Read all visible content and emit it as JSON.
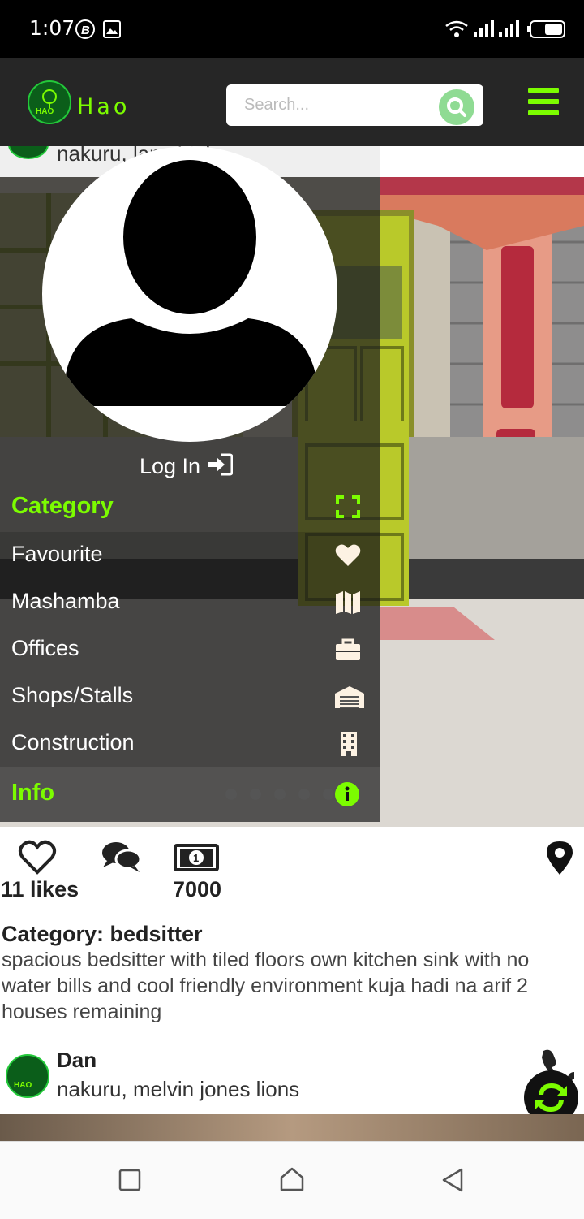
{
  "status_bar": {
    "time": "1:07"
  },
  "header": {
    "app_name": "Hao",
    "logo_text": "HAO",
    "search_placeholder": "Search...",
    "accent": "#7CFC00"
  },
  "drawer": {
    "partial_location": "nakuru, lan   chini",
    "login_label": "Log In",
    "menu": [
      {
        "label": "Category",
        "icon": "expand-icon",
        "heading": true
      },
      {
        "label": "Favourite",
        "icon": "heart-icon"
      },
      {
        "label": "Mashamba",
        "icon": "map-icon"
      },
      {
        "label": "Offices",
        "icon": "briefcase-icon"
      },
      {
        "label": "Shops/Stalls",
        "icon": "warehouse-icon"
      },
      {
        "label": "Construction",
        "icon": "building-icon"
      },
      {
        "label": "Info",
        "icon": "info-icon",
        "heading": true
      }
    ]
  },
  "listing": {
    "likes": "11 likes",
    "price": "7000",
    "category": "Category: bedsitter",
    "description": "spacious bedsitter with tiled floors own kitchen sink with no water bills and cool friendly environment kuja hadi na arif 2 houses remaining"
  },
  "next_listing": {
    "poster_name": "Dan",
    "location": "nakuru, melvin jones lions"
  }
}
